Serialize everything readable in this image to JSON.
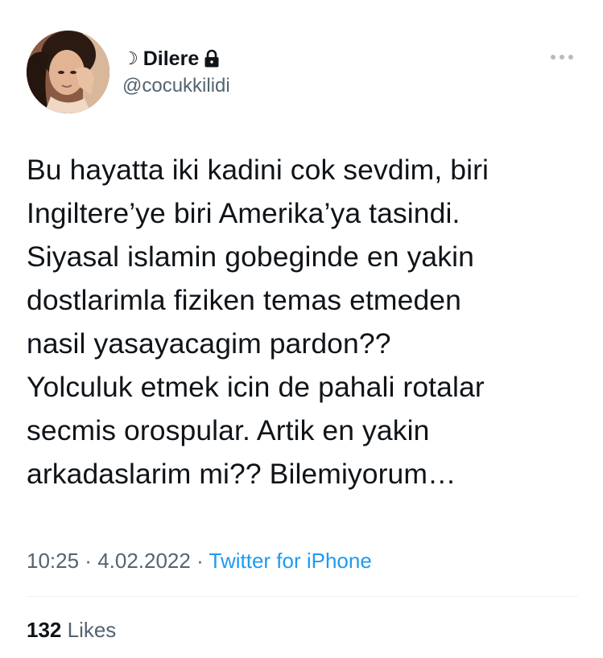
{
  "user": {
    "display_prefix": "☽",
    "display_name": "Dilere",
    "handle": "@cocukkilidi",
    "protected_icon": "lock-icon",
    "avatar": "profile-photo"
  },
  "menu": {
    "icon": "more-options-icon"
  },
  "tweet": {
    "text": "Bu hayatta iki kadini cok sevdim, biri\nIngiltere’ye biri Amerika’ya tasindi.\nSiyasal islamin gobeginde en yakin\ndostlarimla fiziken temas etmeden\nnasil yasayacagim pardon??\nYolculuk etmek icin de pahali rotalar\nsecmis orospular. Artik en yakin\narkadaslarim mi?? Bilemiyorum…"
  },
  "meta": {
    "time": "10:25",
    "separator1": " · ",
    "date": "4.02.2022",
    "separator2": " · ",
    "source": "Twitter for iPhone"
  },
  "stats": {
    "likes_count": "132",
    "likes_label": " Likes"
  },
  "colors": {
    "text_primary": "#0f1419",
    "text_secondary": "#536471",
    "link": "#1d9bf0",
    "divider": "#eff3f4"
  }
}
